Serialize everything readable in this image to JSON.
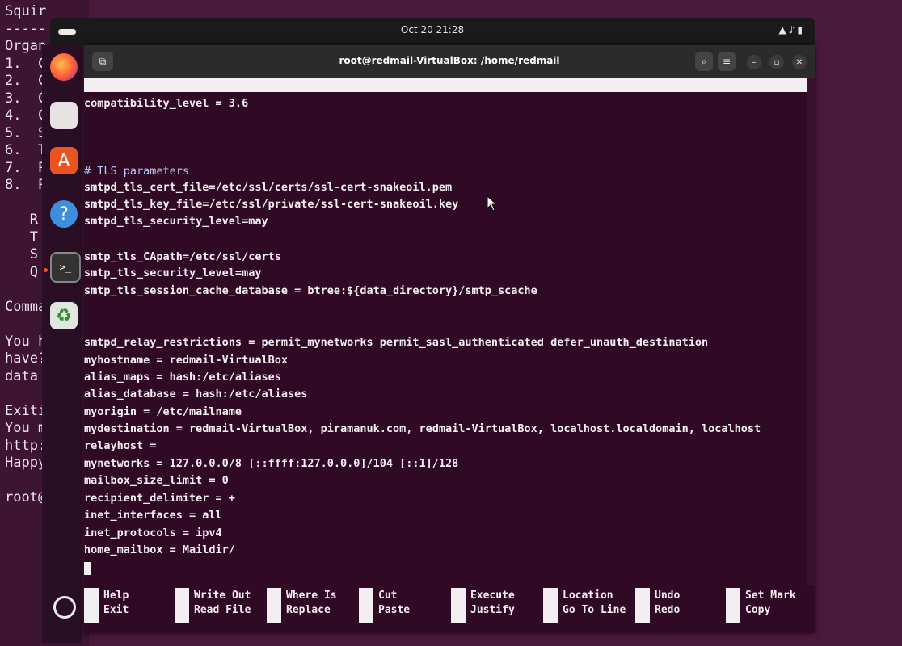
{
  "background_terminal": {
    "lines": [
      "Squir",
      "-----",
      "Organ",
      "1.  C",
      "2.  C",
      "3.  C",
      "4.  C",
      "5.  S",
      "6.  T",
      "7.  P",
      "8.  P",
      "",
      "   R",
      "   T",
      "   S",
      "   Q",
      "",
      "Comma",
      "",
      "You h",
      "have?",
      "data",
      "",
      "Exiti",
      "You m",
      "http:",
      "Happy",
      "",
      "root@"
    ]
  },
  "topbar": {
    "clock": "Oct 20 21:28"
  },
  "dock": {
    "apps": [
      {
        "name": "firefox-icon"
      },
      {
        "name": "files-icon"
      },
      {
        "name": "software-icon"
      },
      {
        "name": "help-icon",
        "glyph": "?"
      },
      {
        "name": "terminal-icon",
        "glyph": ">_"
      },
      {
        "name": "trash-icon",
        "glyph": "♻"
      }
    ]
  },
  "window": {
    "title": "root@redmail-VirtualBox: /home/redmail"
  },
  "editor": {
    "lines": [
      {
        "text": "compatibility_level = 3.6",
        "kind": "code"
      },
      {
        "text": "# TLS parameters",
        "kind": "comment"
      },
      {
        "text": "smtpd_tls_cert_file=/etc/ssl/certs/ssl-cert-snakeoil.pem",
        "kind": "code"
      },
      {
        "text": "smtpd_tls_key_file=/etc/ssl/private/ssl-cert-snakeoil.key",
        "kind": "code"
      },
      {
        "text": "smtpd_tls_security_level=may",
        "kind": "code"
      },
      {
        "text": "smtp_tls_CApath=/etc/ssl/certs",
        "kind": "code"
      },
      {
        "text": "smtp_tls_security_level=may",
        "kind": "code"
      },
      {
        "text": "smtp_tls_session_cache_database = btree:${data_directory}/smtp_scache",
        "kind": "code"
      },
      {
        "text": "smtpd_relay_restrictions = permit_mynetworks permit_sasl_authenticated defer_unauth_destination",
        "kind": "code"
      },
      {
        "text": "myhostname = redmail-VirtualBox",
        "kind": "code"
      },
      {
        "text": "alias_maps = hash:/etc/aliases",
        "kind": "code"
      },
      {
        "text": "alias_database = hash:/etc/aliases",
        "kind": "code"
      },
      {
        "text": "myorigin = /etc/mailname",
        "kind": "code"
      },
      {
        "text": "mydestination = redmail-VirtualBox, piramanuk.com, redmail-VirtualBox, localhost.localdomain, localhost",
        "kind": "code"
      },
      {
        "text": "relayhost =",
        "kind": "code"
      },
      {
        "text": "mynetworks = 127.0.0.0/8 [::ffff:127.0.0.0]/104 [::1]/128",
        "kind": "code"
      },
      {
        "text": "mailbox_size_limit = 0",
        "kind": "code"
      },
      {
        "text": "recipient_delimiter = +",
        "kind": "code"
      },
      {
        "text": "inet_interfaces = all",
        "kind": "code"
      },
      {
        "text": "inet_protocols = ipv4",
        "kind": "code"
      },
      {
        "text": "home_mailbox = Maildir/",
        "kind": "code"
      }
    ]
  },
  "shortcuts": [
    {
      "l1": "Help",
      "l2": "Exit"
    },
    {
      "l1": "Write Out",
      "l2": "Read File"
    },
    {
      "l1": "Where Is",
      "l2": "Replace"
    },
    {
      "l1": "Cut",
      "l2": "Paste"
    },
    {
      "l1": "Execute",
      "l2": "Justify"
    },
    {
      "l1": "Location",
      "l2": "Go To Line"
    },
    {
      "l1": "Undo",
      "l2": "Redo"
    },
    {
      "l1": "Set Mark",
      "l2": "Copy"
    }
  ]
}
